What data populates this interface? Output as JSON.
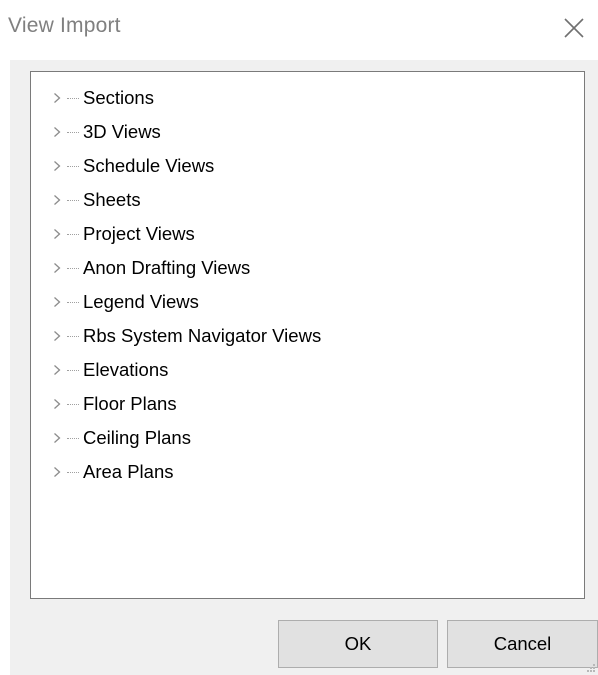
{
  "window": {
    "title": "View Import",
    "close_icon": "close-icon"
  },
  "tree": {
    "expander_icon": "chevron-right-icon",
    "items": [
      {
        "label": "Sections"
      },
      {
        "label": "3D Views"
      },
      {
        "label": "Schedule Views"
      },
      {
        "label": "Sheets"
      },
      {
        "label": "Project Views"
      },
      {
        "label": "Anon Drafting Views"
      },
      {
        "label": "Legend Views"
      },
      {
        "label": "Rbs System Navigator Views"
      },
      {
        "label": "Elevations"
      },
      {
        "label": "Floor Plans"
      },
      {
        "label": "Ceiling Plans"
      },
      {
        "label": "Area Plans"
      }
    ]
  },
  "buttons": {
    "ok_label": "OK",
    "cancel_label": "Cancel"
  },
  "colors": {
    "title_text": "#808080",
    "client_background": "#f0f0f0",
    "tree_border": "#7a7a7a",
    "button_face": "#e1e1e1",
    "button_border": "#adadad",
    "expander": "#8c8c8c"
  }
}
